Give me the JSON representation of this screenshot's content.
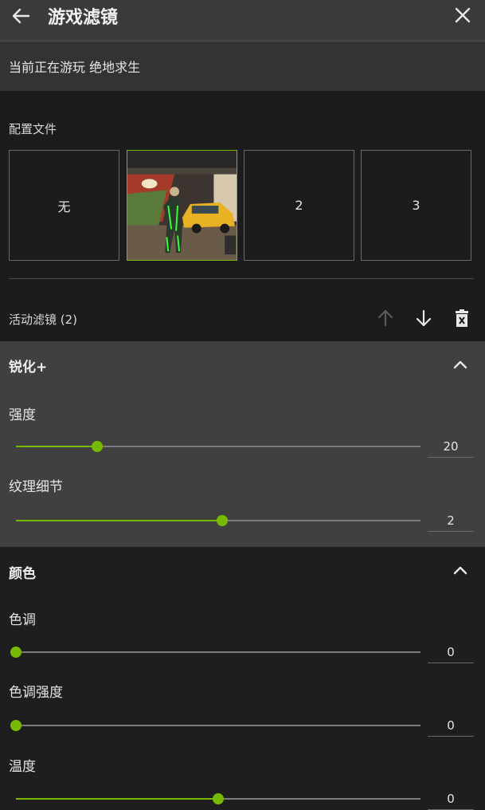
{
  "header": {
    "title": "游戏滤镜"
  },
  "now_playing": {
    "text": "当前正在游玩 绝地求生"
  },
  "profiles": {
    "label": "配置文件",
    "tiles": [
      {
        "label": "无"
      },
      {
        "label": "",
        "selected": true
      },
      {
        "label": "2"
      },
      {
        "label": "3"
      }
    ]
  },
  "active_filters": {
    "label": "活动滤镜 (2)"
  },
  "filters": {
    "sharpen": {
      "title": "锐化+",
      "params": [
        {
          "label": "强度",
          "value": "20",
          "level": 0.2
        },
        {
          "label": "纹理细节",
          "value": "2",
          "level": 0.51
        }
      ]
    },
    "color": {
      "title": "颜色",
      "params": [
        {
          "label": "色调",
          "value": "0",
          "level": 0.0
        },
        {
          "label": "色调强度",
          "value": "0",
          "level": 0.0
        },
        {
          "label": "温度",
          "value": "0",
          "level": 0.5
        }
      ]
    }
  },
  "colors": {
    "accent": "#76b900",
    "header_bg": "#3a3a3a",
    "panel_bg": "#404040"
  },
  "icons": [
    "back-arrow-icon",
    "close-icon",
    "arrow-up-icon",
    "arrow-down-icon",
    "delete-icon",
    "chevron-up-icon"
  ]
}
